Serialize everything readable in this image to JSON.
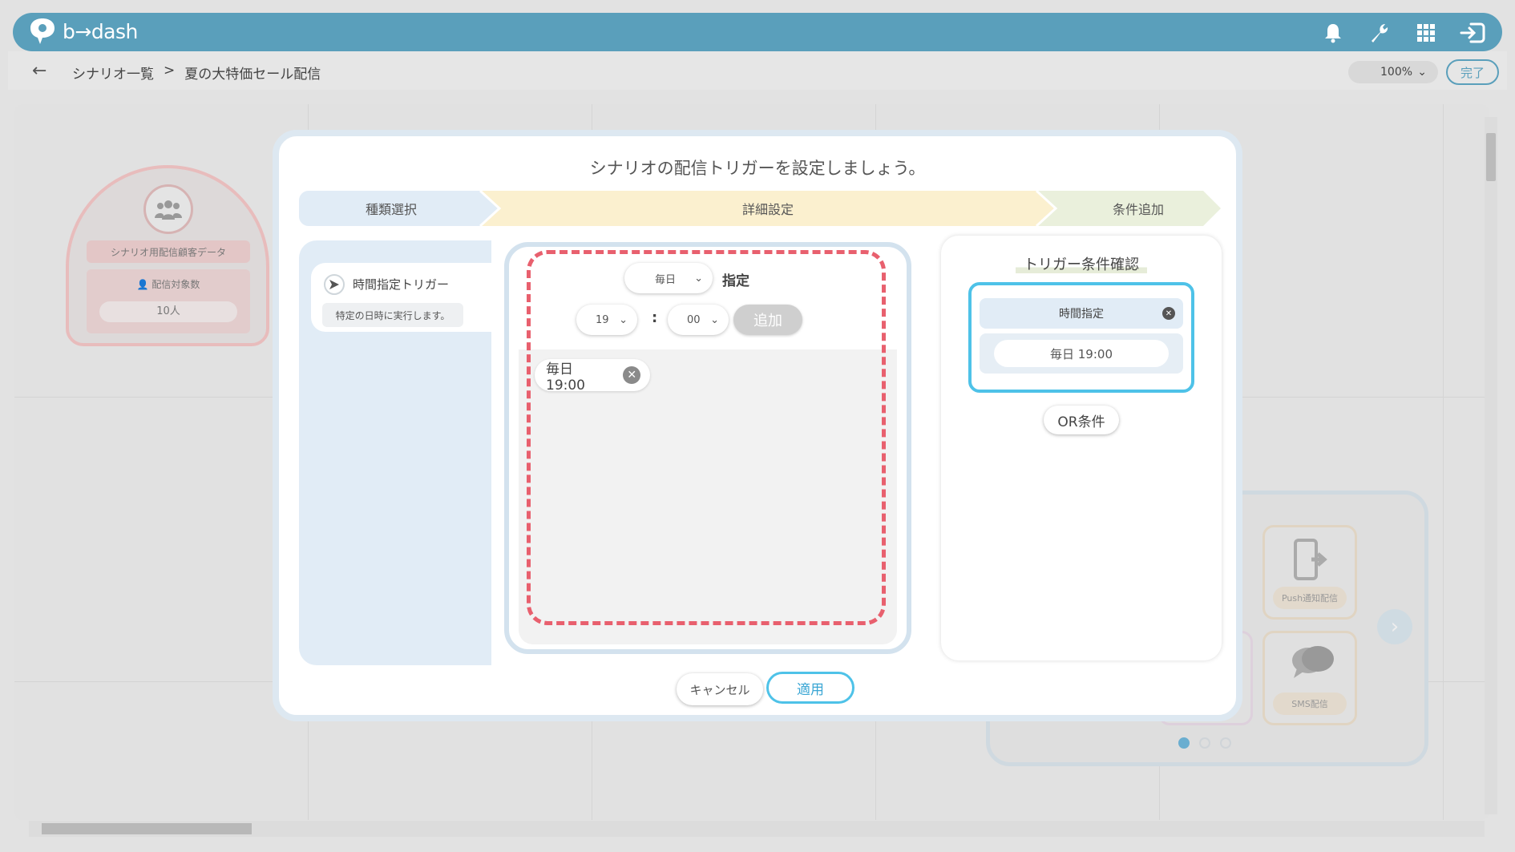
{
  "app": {
    "logo_text": "b→dash"
  },
  "header": {
    "icons": [
      "bell-icon",
      "wrench-icon",
      "grid-icon",
      "logout-icon"
    ]
  },
  "breadcrumb": {
    "parent": "シナリオ一覧",
    "separator": ">",
    "current": "夏の大特価セール配信"
  },
  "zoom": {
    "value": "100%"
  },
  "done_label": "完了",
  "background": {
    "node_title": "シナリオ用配信顧客データ",
    "node_label": "配信対象数",
    "node_value": "10人",
    "card_push": "Push通知配信",
    "card_sms": "SMS配信"
  },
  "modal": {
    "title": "シナリオの配信トリガーを設定しましょう。",
    "steps": [
      "種類選択",
      "詳細設定",
      "条件追加"
    ],
    "trigger": {
      "name": "時間指定トリガー",
      "desc": "特定の日時に実行します。"
    },
    "frequency": {
      "selected": "毎日",
      "suffix": "指定"
    },
    "hour": "19",
    "colon": ":",
    "minute": "00",
    "add_label": "追加",
    "chips": [
      "毎日 19:00"
    ],
    "confirm": {
      "title": "トリガー条件確認",
      "cond_head": "時間指定",
      "cond_value": "毎日 19:00",
      "or_label": "OR条件"
    },
    "cancel_label": "キャンセル",
    "apply_label": "適用"
  },
  "colors": {
    "header": "#5a9fbb",
    "accent": "#4ec2e8",
    "step1": "#e1ecf6",
    "step2": "#fbf0cf",
    "step3": "#eaf0dc",
    "highlight": "#e8606e"
  }
}
